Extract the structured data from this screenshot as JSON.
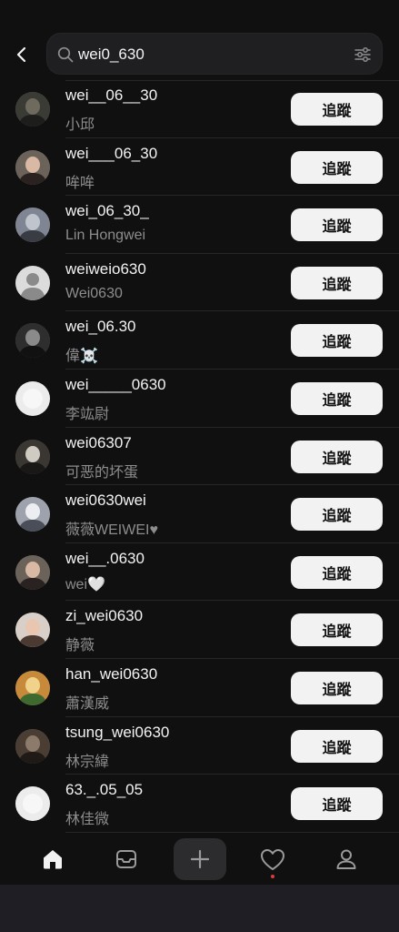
{
  "search": {
    "query": "wei0_630"
  },
  "follow_label": "追蹤",
  "icons": {
    "back": "chevron-left-icon",
    "search": "magnifier-icon",
    "filter": "sliders-icon",
    "home": "home-icon",
    "messages": "inbox-icon",
    "create": "plus-icon",
    "activity": "heart-icon",
    "profile": "person-icon"
  },
  "colors": {
    "background": "#101010",
    "button": "#f2f2f2",
    "secondary_text": "#8d8d8d",
    "notification_dot": "#e03b3b"
  },
  "results": [
    {
      "username": "wei__06__30",
      "name": "小邱",
      "avatar": "photo-dark"
    },
    {
      "username": "wei___06_30",
      "name": "哞哞",
      "avatar": "photo-girl"
    },
    {
      "username": "wei_06_30_",
      "name": "Lin Hongwei",
      "avatar": "photo-street"
    },
    {
      "username": "weiweio630",
      "name": "Wei0630",
      "avatar": "default"
    },
    {
      "username": "wei_06.30",
      "name": "偉☠️",
      "avatar": "photo-bw"
    },
    {
      "username": "wei_____0630",
      "name": "李竑尉",
      "avatar": "blank"
    },
    {
      "username": "wei06307",
      "name": "可恶的坏蛋",
      "avatar": "photo-dog"
    },
    {
      "username": "wei0630wei",
      "name": "薇薇WEIWEI♥",
      "avatar": "photo-white"
    },
    {
      "username": "wei__.0630",
      "name": "wei🤍",
      "avatar": "photo-girl"
    },
    {
      "username": "zi_wei0630",
      "name": "静薇",
      "avatar": "photo-girl-light"
    },
    {
      "username": "han_wei0630",
      "name": "蕭漢威",
      "avatar": "photo-orange"
    },
    {
      "username": "tsung_wei0630",
      "name": "林宗緯",
      "avatar": "photo-cage"
    },
    {
      "username": "63._.05_05",
      "name": "林佳微",
      "avatar": "blank"
    }
  ]
}
